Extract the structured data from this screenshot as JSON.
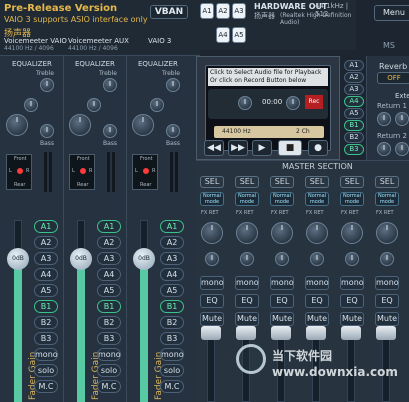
{
  "title": {
    "main": "Pre-Release Version",
    "sub": "VAIO 3 supports ASIO interface only",
    "app_cn": "扬声器",
    "vban_btn": "VBAN"
  },
  "hw_buttons": [
    "A1",
    "A2",
    "A3",
    "A4",
    "A5"
  ],
  "hw_out": {
    "label": "HARDWARE OUT",
    "info": "44.1kHz | 512",
    "device_cn": "扬声器",
    "device": "(Realtek High Definition Audio)"
  },
  "menu": {
    "label": "Menu"
  },
  "inputs": [
    {
      "name": "Voicemeeter VAIO",
      "info": "44100 Hz / 4096"
    },
    {
      "name": "Voicemeeter AUX",
      "info": "44100 Hz / 4096"
    },
    {
      "name": "VAIO 3",
      "info": ""
    }
  ],
  "equalizer": {
    "label": "EQUALIZER",
    "treble": "Treble",
    "bass": "Bass"
  },
  "pan": {
    "front": "Front",
    "rear": "Rear",
    "l": "L",
    "r": "R"
  },
  "recorder": {
    "line1": "Click to Select Audio file for Playback",
    "line2": "Or click on Record Button below",
    "time": "00:00",
    "rec_btn": "Rec",
    "rate": "44100 Hz",
    "channels": "2 Ch",
    "bus_buttons": [
      "A1",
      "A2",
      "A3",
      "A4",
      "A5",
      "B1",
      "B2",
      "B3"
    ]
  },
  "reverb": {
    "label": "Reverb",
    "state": "OFF",
    "ext": "Exte",
    "return1": "Return 1",
    "return2": "Return 2"
  },
  "master": {
    "label": "MASTER SECTION",
    "sel": "SEL",
    "mode": "Normal mode",
    "fx": "FX RET",
    "mono": "mono",
    "eq": "EQ",
    "mute": "Mute"
  },
  "strip_buttons": [
    "A1",
    "A2",
    "A3",
    "A4",
    "A5",
    "B1",
    "B2",
    "B3",
    "mono",
    "solo",
    "M.C"
  ],
  "strips": [
    {
      "gain": "0dB",
      "label": "Fader Gain",
      "level": 0.78
    },
    {
      "gain": "0dB",
      "label": "Fader Gain",
      "level": 0.78
    },
    {
      "gain": "0dB",
      "label": "Fader Gain",
      "level": 0.78
    }
  ],
  "watermark": "当下软件园 www.downxia.com",
  "right_sliver": "MS",
  "accent": "#57c9a3",
  "gold": "#d9b25a"
}
